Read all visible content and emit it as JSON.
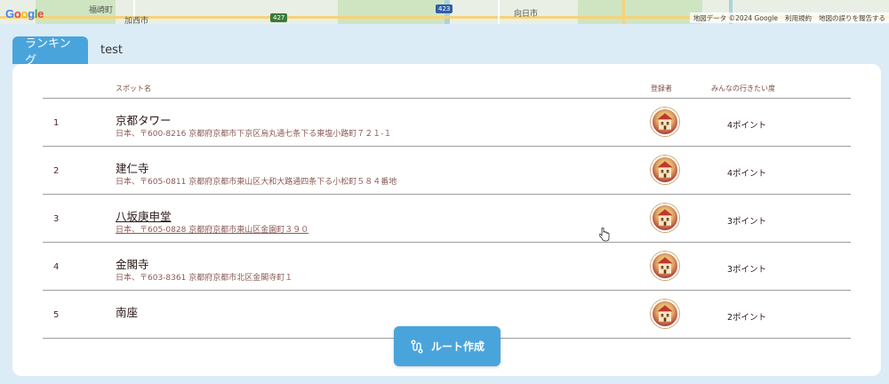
{
  "map": {
    "labels": [
      "福崎町",
      "加西市",
      "向日市"
    ],
    "road_numbers": [
      "427",
      "423"
    ],
    "attribution": [
      "地図データ ©2024 Google",
      "利用規約",
      "地図の誤りを報告する"
    ],
    "logo_letters": [
      "G",
      "o",
      "o",
      "g",
      "l",
      "e"
    ]
  },
  "tabs": [
    {
      "label": "ランキング",
      "active": true
    },
    {
      "label": "test",
      "active": false
    }
  ],
  "table": {
    "headers": {
      "name": "スポット名",
      "registrant": "登録者",
      "points": "みんなの行きたい度"
    },
    "rows": [
      {
        "rank": "1",
        "name": "京都タワー",
        "address": "日本、〒600-8216 京都府京都市下京区烏丸通七条下る東塩小路町７２１-１",
        "points": "4ポイント"
      },
      {
        "rank": "2",
        "name": "建仁寺",
        "address": "日本、〒605-0811 京都府京都市東山区大和大路通四条下る小松町５８４番地",
        "points": "4ポイント"
      },
      {
        "rank": "3",
        "name": "八坂庚申堂",
        "address": "日本、〒605-0828 京都府京都市東山区金園町３９０",
        "points": "3ポイント"
      },
      {
        "rank": "4",
        "name": "金閣寺",
        "address": "日本、〒603-8361 京都府京都市北区金閣寺町１",
        "points": "3ポイント"
      },
      {
        "rank": "5",
        "name": "南座",
        "address": "",
        "points": "2ポイント"
      }
    ]
  },
  "route_button": {
    "label": "ルート作成",
    "icon": "route-icon"
  },
  "colors": {
    "accent": "#4aa4dc",
    "background": "#dcecf7",
    "text": "#4a2a22"
  }
}
